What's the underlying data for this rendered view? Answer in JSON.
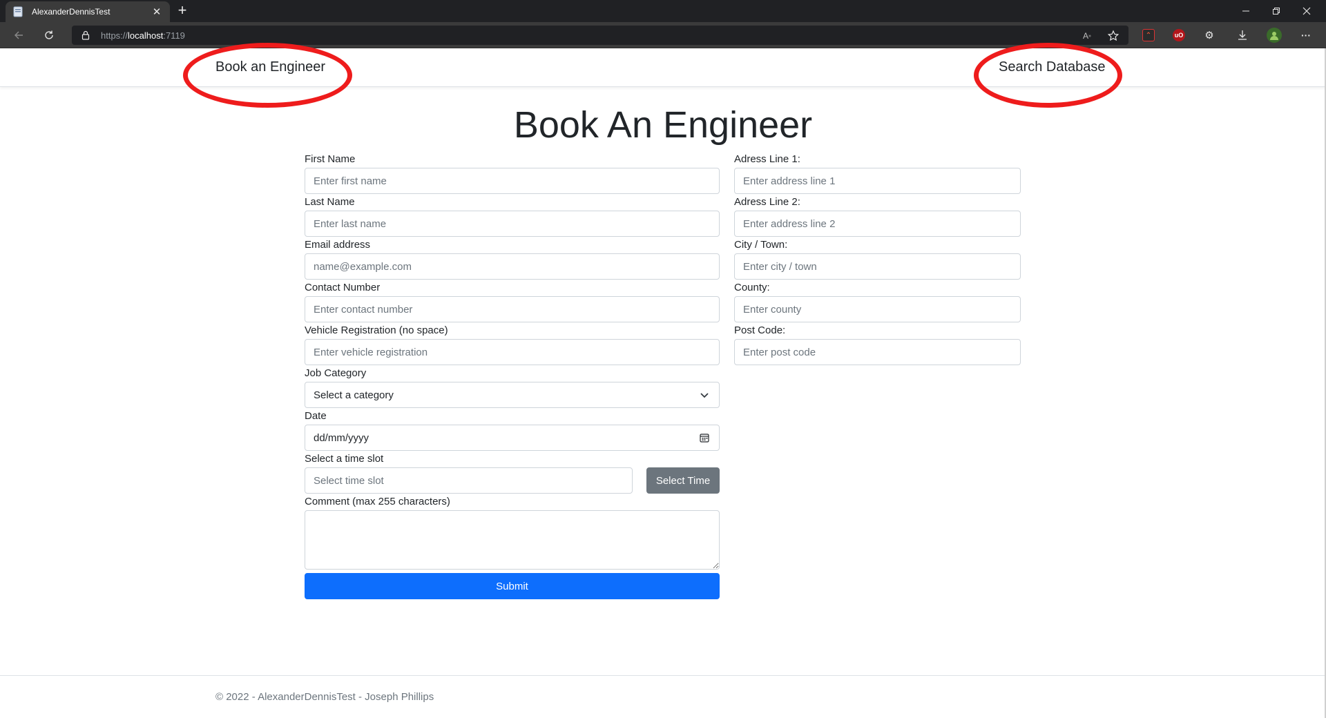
{
  "browser": {
    "tab_title": "AlexanderDennisTest",
    "url_protocol": "https://",
    "url_host": "localhost",
    "url_port": ":7119"
  },
  "nav": {
    "left_link": "Book an Engineer",
    "right_link": "Search Database"
  },
  "page_title": "Book An Engineer",
  "form": {
    "first_name": {
      "label": "First Name",
      "placeholder": "Enter first name"
    },
    "last_name": {
      "label": "Last Name",
      "placeholder": "Enter last name"
    },
    "email": {
      "label": "Email address",
      "placeholder": "name@example.com"
    },
    "contact": {
      "label": "Contact Number",
      "placeholder": "Enter contact number"
    },
    "vehicle": {
      "label": "Vehicle Registration (no space)",
      "placeholder": "Enter vehicle registration"
    },
    "job_category": {
      "label": "Job Category",
      "value": "Select a category"
    },
    "date": {
      "label": "Date",
      "value": "dd/mm/yyyy"
    },
    "time_slot": {
      "label": "Select a time slot",
      "placeholder": "Select time slot",
      "button": "Select Time"
    },
    "comment": {
      "label": "Comment (max 255 characters)"
    },
    "submit": "Submit",
    "address1": {
      "label": "Adress Line 1:",
      "placeholder": "Enter address line 1"
    },
    "address2": {
      "label": "Adress Line 2:",
      "placeholder": "Enter address line 2"
    },
    "city": {
      "label": "City / Town:",
      "placeholder": "Enter city / town"
    },
    "county": {
      "label": "County:",
      "placeholder": "Enter county"
    },
    "postcode": {
      "label": "Post Code:",
      "placeholder": "Enter post code"
    }
  },
  "footer": "© 2022 - AlexanderDennisTest - Joseph Phillips",
  "colors": {
    "primary": "#0d6efd",
    "secondary": "#6c757d",
    "annotation": "#ee1c1c"
  }
}
